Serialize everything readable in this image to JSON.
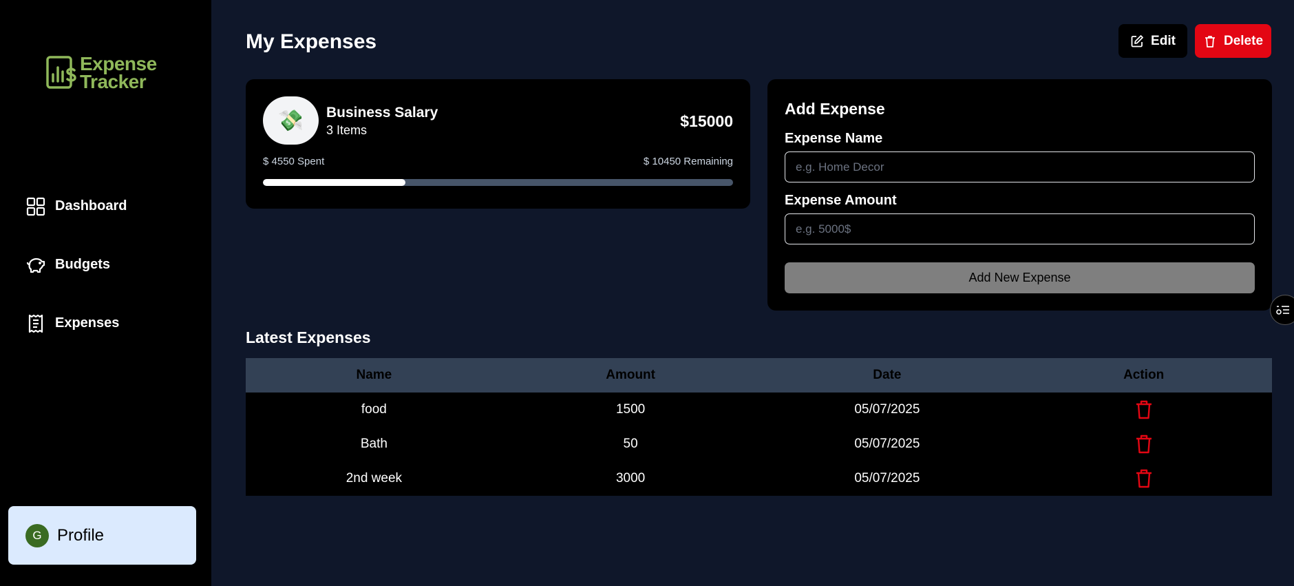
{
  "sidebar": {
    "logo": {
      "line1": "Expense",
      "line2": "Tracker"
    },
    "items": [
      {
        "label": "Dashboard",
        "icon": "grid-icon"
      },
      {
        "label": "Budgets",
        "icon": "piggy-bank-icon"
      },
      {
        "label": "Expenses",
        "icon": "receipt-icon"
      }
    ],
    "profile": {
      "initial": "G",
      "label": "Profile"
    }
  },
  "header": {
    "title": "My Expenses",
    "edit_label": "Edit",
    "delete_label": "Delete"
  },
  "budget": {
    "icon": "💸",
    "name": "Business Salary",
    "items": "3 Items",
    "amount": "$15000",
    "spent": "$ 4550 Spent",
    "remaining": "$ 10450 Remaining",
    "progress_fraction": 0.3033
  },
  "add_expense": {
    "title": "Add Expense",
    "name_label": "Expense Name",
    "name_placeholder": "e.g. Home Decor",
    "amount_label": "Expense Amount",
    "amount_placeholder": "e.g. 5000$",
    "button_label": "Add New Expense"
  },
  "latest": {
    "title": "Latest Expenses",
    "columns": [
      "Name",
      "Amount",
      "Date",
      "Action"
    ],
    "rows": [
      {
        "name": "food",
        "amount": "1500",
        "date": "05/07/2025"
      },
      {
        "name": "Bath",
        "amount": "50",
        "date": "05/07/2025"
      },
      {
        "name": "2nd week",
        "amount": "3000",
        "date": "05/07/2025"
      }
    ]
  },
  "colors": {
    "accent_logo": "#8fb85a",
    "delete_red": "#e30613",
    "background": "#0f172a"
  }
}
